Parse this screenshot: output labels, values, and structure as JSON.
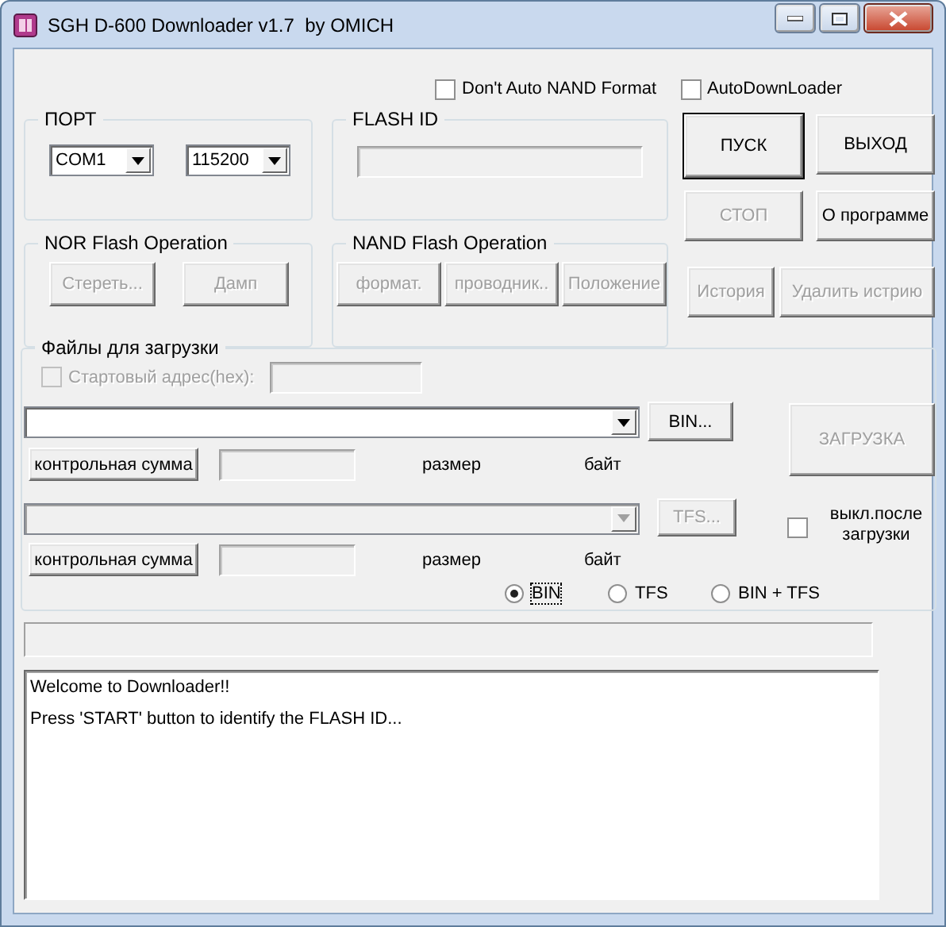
{
  "window": {
    "title": "SGH D-600 Downloader v1.7  by OMICH"
  },
  "options": [
    {
      "label": "Don't Auto NAND Format",
      "checked": false
    },
    {
      "label": "AutoDownLoader",
      "checked": false
    }
  ],
  "port": {
    "title": "ПОРТ",
    "port": "COM1",
    "baud": "115200"
  },
  "flash_id": {
    "title": "FLASH ID"
  },
  "actions": [
    {
      "label": "ПУСК",
      "disabled": false,
      "default": true
    },
    {
      "label": "ВЫХОД",
      "disabled": false,
      "default": false
    },
    {
      "label": "СТОП",
      "disabled": true,
      "default": false
    },
    {
      "label": "О программе",
      "disabled": false,
      "default": false
    },
    {
      "label": "История",
      "disabled": true,
      "default": false
    },
    {
      "label": "Удалить истрию",
      "disabled": true,
      "default": false
    }
  ],
  "nor": {
    "title": "NOR Flash Operation",
    "buttons": [
      {
        "label": "Стереть...",
        "disabled": true
      },
      {
        "label": "Дамп",
        "disabled": true
      }
    ]
  },
  "nand": {
    "title": "NAND Flash Operation",
    "buttons": [
      {
        "label": "формат.",
        "disabled": true
      },
      {
        "label": "проводник..",
        "disabled": true
      },
      {
        "label": "Положение",
        "disabled": true
      }
    ]
  },
  "files": {
    "title": "Файлы для загрузки",
    "start_address": {
      "label": "Стартовый адрес(hex):",
      "checked": false,
      "disabled": true
    },
    "slots": [
      {
        "disabled": false,
        "browse": {
          "label": "BIN...",
          "disabled": false
        },
        "checksum": "контрольная сумма",
        "size_label": "размер",
        "unit": "байт"
      },
      {
        "disabled": true,
        "browse": {
          "label": "TFS...",
          "disabled": true
        },
        "checksum": "контрольная сумма",
        "size_label": "размер",
        "unit": "байт"
      }
    ],
    "download": {
      "label": "ЗАГРУЗКА",
      "disabled": true
    },
    "power_off": {
      "label": "выкл.после загрузки",
      "checked": false
    },
    "modes": [
      {
        "label": "BIN",
        "selected": true
      },
      {
        "label": "TFS",
        "selected": false
      },
      {
        "label": "BIN + TFS",
        "selected": false
      }
    ]
  },
  "progress": {
    "level": 0
  },
  "log": [
    "Welcome to Downloader!!",
    "Press 'START' button to identify the FLASH ID..."
  ]
}
